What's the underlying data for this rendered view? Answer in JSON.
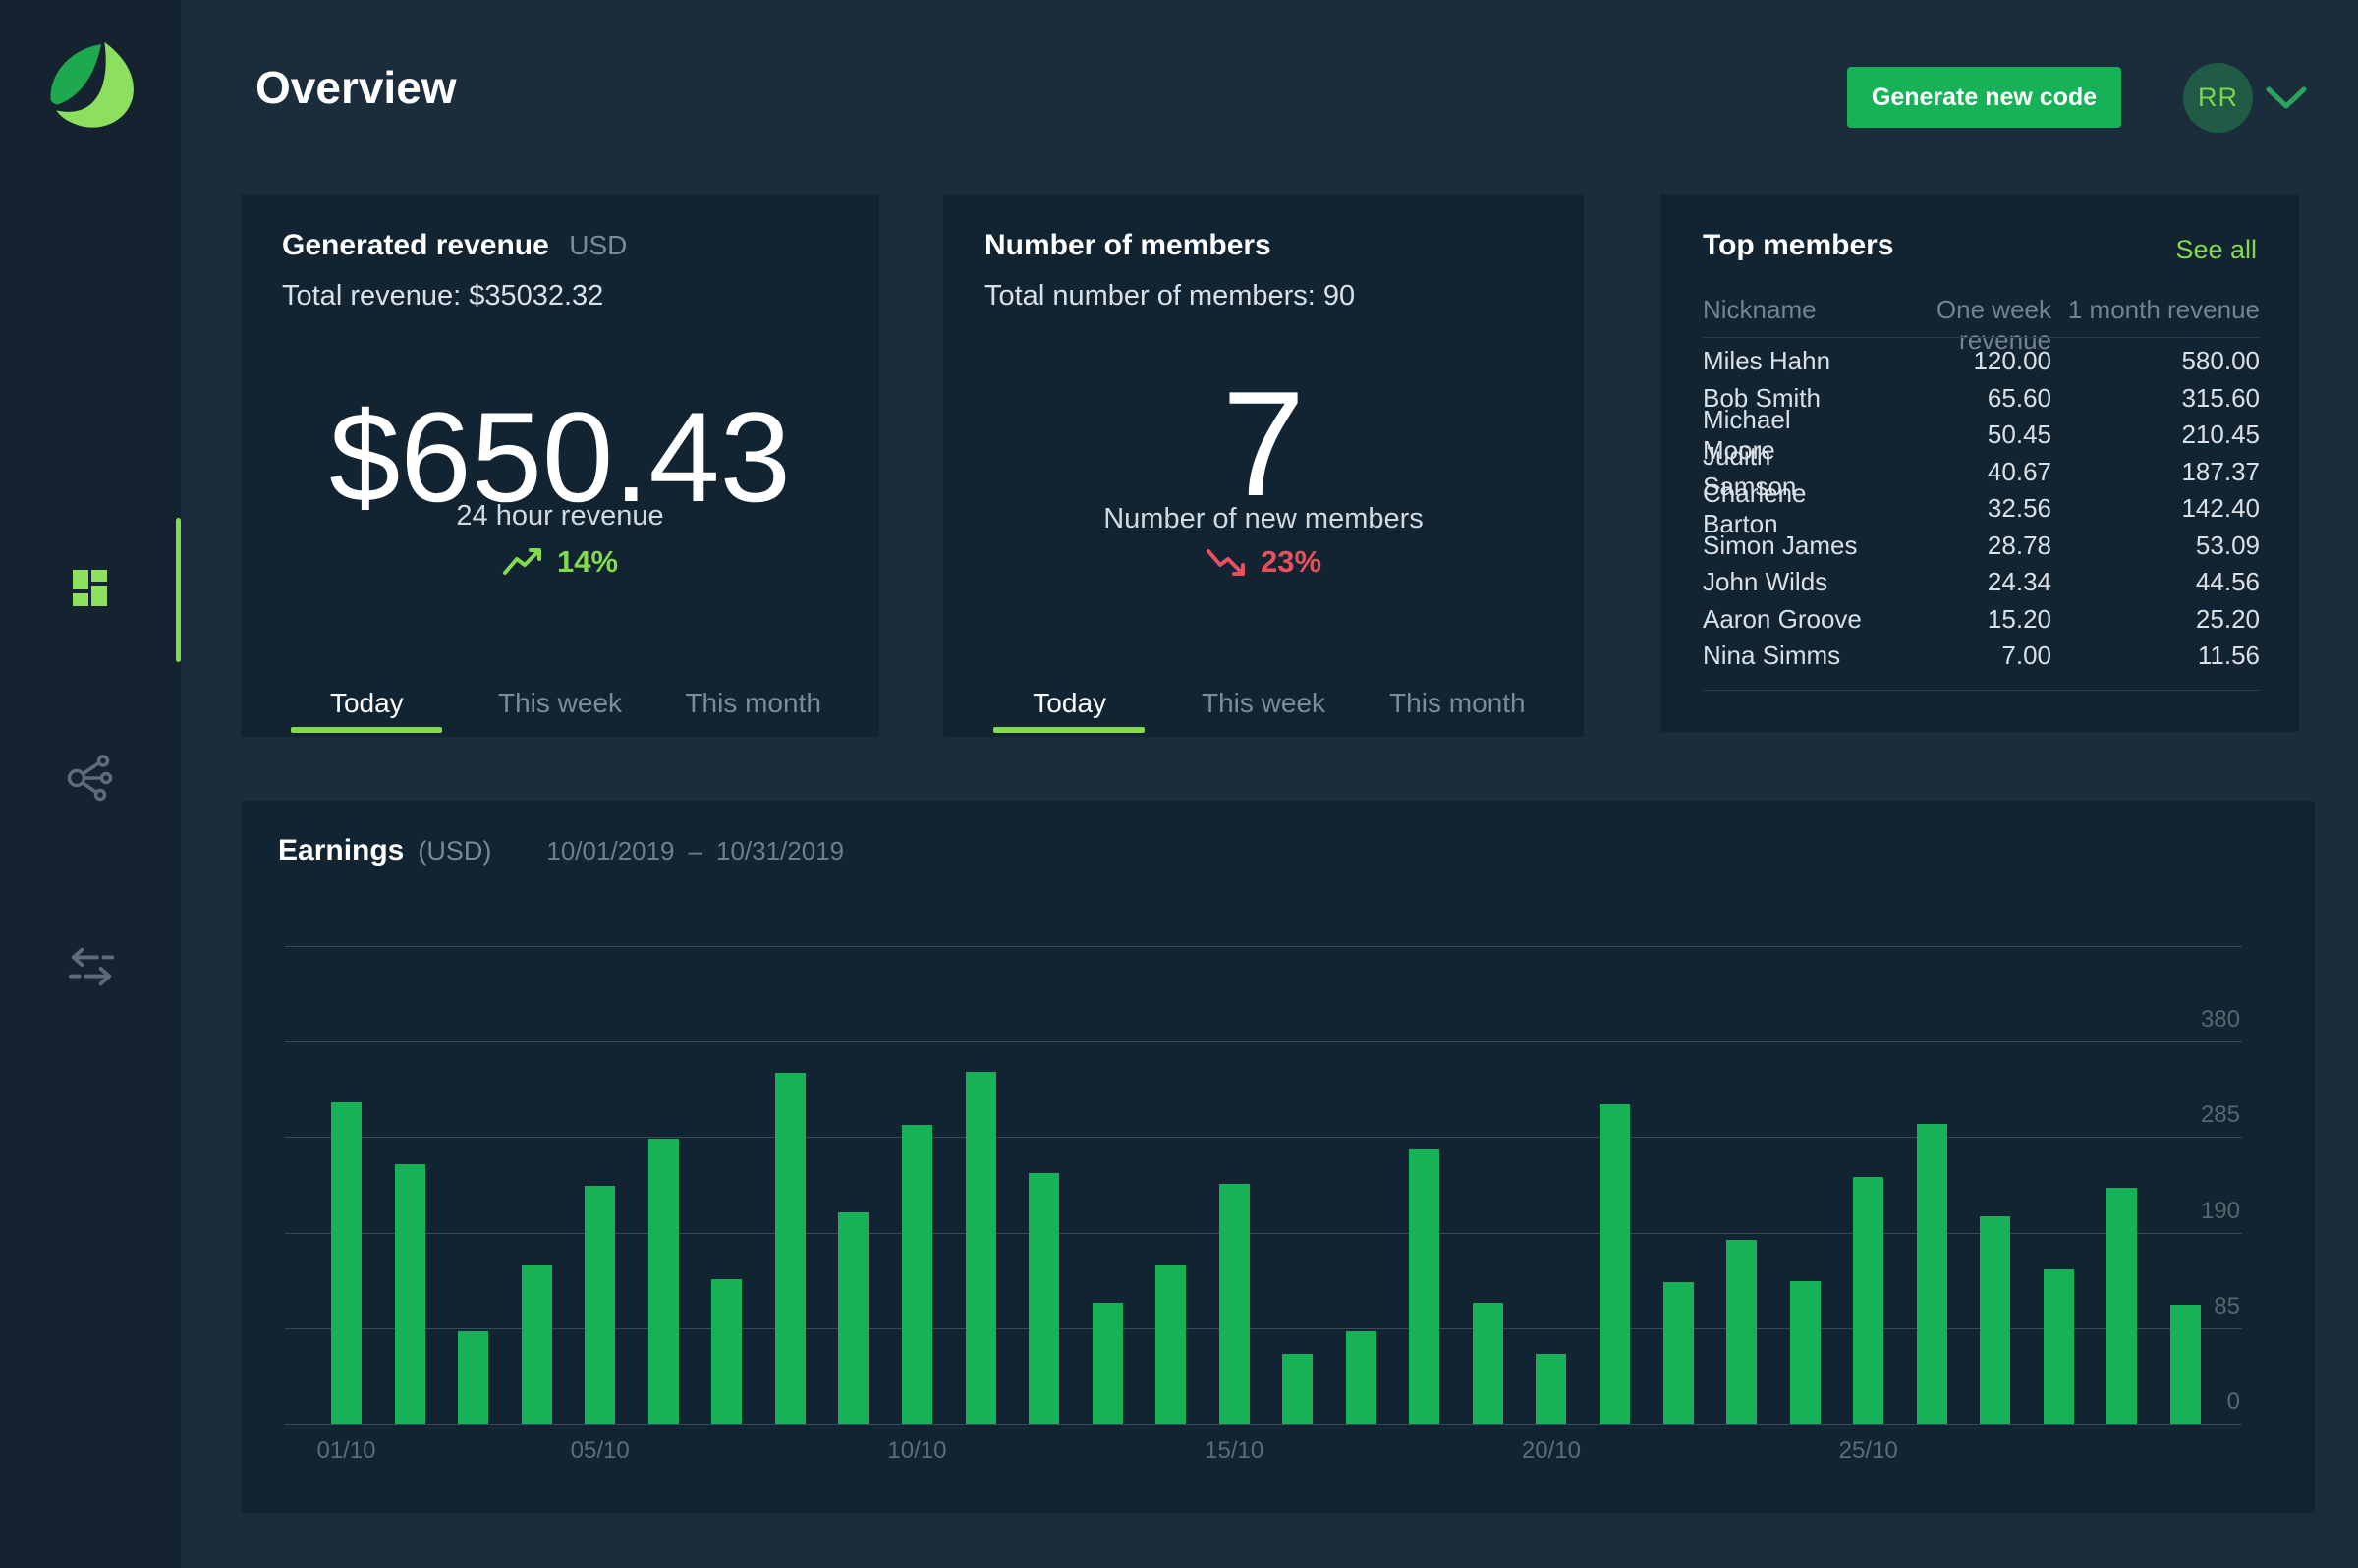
{
  "header": {
    "title": "Overview",
    "generate_button": "Generate new code",
    "avatar_initials": "RR"
  },
  "sidebar": {
    "items": [
      {
        "id": "dashboard",
        "icon": "dashboard-grid-icon",
        "active": true
      },
      {
        "id": "affiliates",
        "icon": "share-network-icon",
        "active": false
      },
      {
        "id": "transfers",
        "icon": "transfer-arrows-icon",
        "active": false
      }
    ]
  },
  "revenue_card": {
    "title": "Generated revenue",
    "currency": "USD",
    "subtitle": "Total revenue: $35032.32",
    "value": "$650.43",
    "value_caption": "24 hour revenue",
    "delta": {
      "text": "14%",
      "direction": "up"
    },
    "tabs": {
      "labels": [
        "Today",
        "This week",
        "This month"
      ],
      "active_index": 0
    }
  },
  "members_card": {
    "title": "Number of members",
    "subtitle": "Total number of members: 90",
    "value": "7",
    "value_caption": "Number of new members",
    "delta": {
      "text": "23%",
      "direction": "down"
    },
    "tabs": {
      "labels": [
        "Today",
        "This week",
        "This month"
      ],
      "active_index": 0
    }
  },
  "top_members_card": {
    "title": "Top members",
    "see_all": "See all",
    "columns": [
      "Nickname",
      "One week revenue",
      "1 month revenue"
    ],
    "rows": [
      [
        "Miles Hahn",
        "120.00",
        "580.00"
      ],
      [
        "Bob Smith",
        "65.60",
        "315.60"
      ],
      [
        "Michael Moore",
        "50.45",
        "210.45"
      ],
      [
        "Judith Samson",
        "40.67",
        "187.37"
      ],
      [
        "Charlene Barton",
        "32.56",
        "142.40"
      ],
      [
        "Simon James",
        "28.78",
        "53.09"
      ],
      [
        "John Wilds",
        "24.34",
        "44.56"
      ],
      [
        "Aaron Groove",
        "15.20",
        "25.20"
      ],
      [
        "Nina Simms",
        "7.00",
        "11.56"
      ]
    ]
  },
  "earnings_panel": {
    "title": "Earnings",
    "currency_label": "(USD)",
    "date_from": "10/01/2019",
    "date_separator": "–",
    "date_to": "10/31/2019"
  },
  "chart_data": {
    "type": "bar",
    "title": "Earnings (USD) 10/01/2019 – 10/31/2019",
    "categories": [
      "01/10",
      "02/10",
      "03/10",
      "04/10",
      "05/10",
      "06/10",
      "07/10",
      "08/10",
      "09/10",
      "10/10",
      "11/10",
      "12/10",
      "13/10",
      "14/10",
      "15/10",
      "16/10",
      "17/10",
      "18/10",
      "19/10",
      "20/10",
      "21/10",
      "22/10",
      "23/10",
      "24/10",
      "25/10",
      "26/10",
      "27/10",
      "28/10",
      "29/10",
      "30/10"
    ],
    "values": [
      320,
      258,
      82,
      154,
      237,
      283,
      139,
      349,
      210,
      297,
      350,
      249,
      113,
      154,
      238,
      62,
      82,
      273,
      113,
      62,
      318,
      136,
      182,
      137,
      245,
      298,
      206,
      150,
      235,
      111
    ],
    "xlabel": "",
    "ylabel": "",
    "y_ticks": [
      0,
      85,
      190,
      285,
      380
    ],
    "y_axis_headroom": 475,
    "x_ticks_shown": [
      "01/10",
      "05/10",
      "10/10",
      "15/10",
      "20/10",
      "25/10"
    ],
    "grid": true,
    "legend": "none",
    "bar_color": "#17b157"
  },
  "colors": {
    "accent_lime": "#84d94e",
    "positive_green": "#17b157",
    "negative_red": "#e8505f",
    "page_bg": "#1b2c3c",
    "card_bg": "#122331",
    "sidebar_bg": "#152330"
  }
}
